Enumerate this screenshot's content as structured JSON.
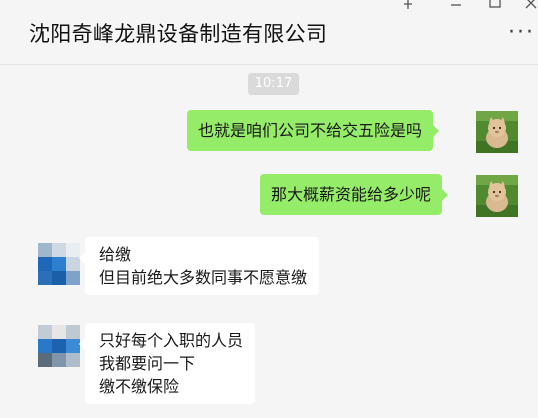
{
  "window": {
    "title": "沈阳奇峰龙鼎设备制造有限公司",
    "more_label": "···"
  },
  "chat": {
    "timestamp": "10:17",
    "messages": [
      {
        "sender": "me",
        "lines": [
          "也就是咱们公司不给交五险是吗"
        ]
      },
      {
        "sender": "me",
        "lines": [
          "那大概薪资能给多少呢"
        ]
      },
      {
        "sender": "contact",
        "lines": [
          "给缴",
          "但目前绝大多数同事不愿意缴"
        ]
      },
      {
        "sender": "contact",
        "lines": [
          "只好每个入职的人员",
          "我都要问一下",
          "缴不缴保险"
        ]
      }
    ]
  },
  "colors": {
    "outgoing_bubble": "#95ec69",
    "incoming_bubble": "#ffffff",
    "background": "#f5f5f5",
    "timestamp_bg": "#dadada"
  },
  "icons": {
    "my_avatar": "cat-figurine-on-grass",
    "contact_avatar": "blue-pixel-mosaic",
    "more": "ellipsis-icon",
    "pin": "pin-icon",
    "minimize": "minimize-icon",
    "maximize": "maximize-icon",
    "close": "close-icon"
  }
}
